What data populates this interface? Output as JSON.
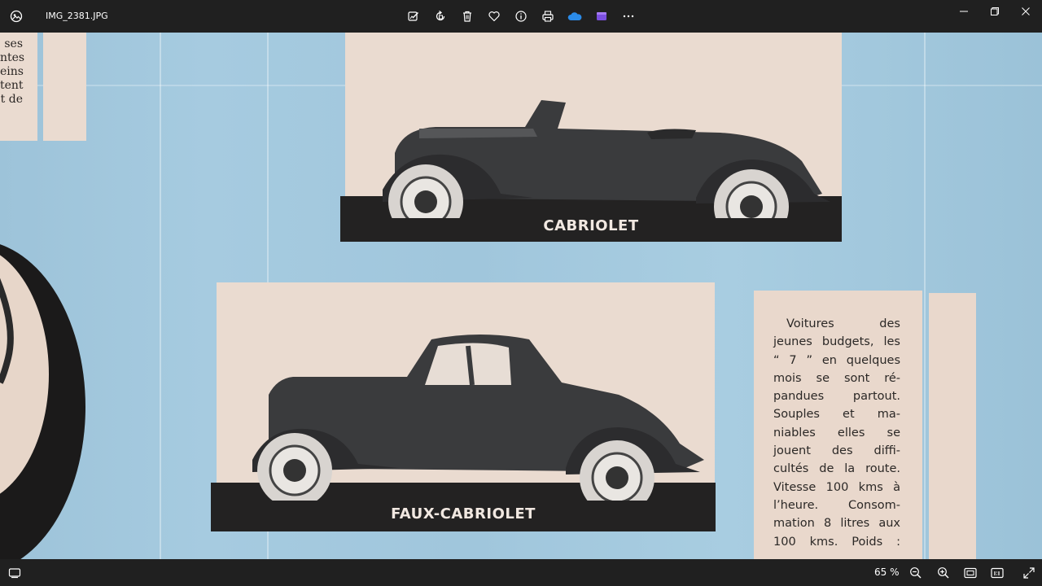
{
  "window": {
    "file_name": "IMG_2381.JPG",
    "app_icon": "photos-app-icon",
    "toolbar": [
      {
        "name": "edit-image-icon"
      },
      {
        "name": "rotate-icon"
      },
      {
        "name": "delete-icon"
      },
      {
        "name": "favorite-heart-icon"
      },
      {
        "name": "file-info-icon"
      },
      {
        "name": "print-icon"
      },
      {
        "name": "onedrive-cloud-icon",
        "color": "#2b8be8"
      },
      {
        "name": "clipchamp-icon",
        "color": "#7b4fe0"
      },
      {
        "name": "more-options-icon"
      }
    ],
    "controls": [
      "minimize-icon",
      "maximize-icon",
      "close-icon"
    ]
  },
  "photo": {
    "top_caption": "CABRIOLET",
    "bottom_caption": "FAUX-CABRIOLET",
    "left_fragment": [
      "ses",
      "ntes",
      "eins",
      "tent",
      "t de"
    ],
    "body_lines": [
      "Voitures des",
      "jeunes budgets, les",
      "“ 7 ” en quelques",
      "mois se sont ré-",
      "pandues partout.",
      "Souples et ma-",
      "niables elles se",
      "jouent des diffi-",
      "cultés de la route.",
      "Vitesse 100 kms à",
      "l’heure. Consom-",
      "mation 8 litres aux",
      "100 kms. Poids :"
    ]
  },
  "status": {
    "zoom_label": "65 %",
    "buttons": [
      "zoom-out-icon",
      "zoom-in-icon",
      "fit-to-window-icon",
      "actual-size-icon",
      "fullscreen-icon"
    ]
  }
}
